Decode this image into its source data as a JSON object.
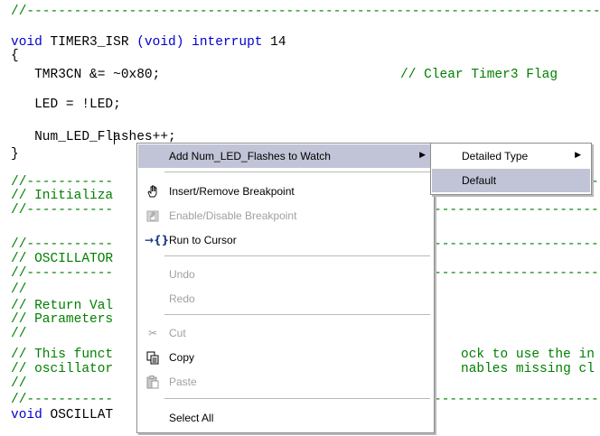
{
  "code_lines": {
    "l1": "//---------------------------------------------------------------------------",
    "l2_void": "void",
    "l2_name": " TIMER3_ISR ",
    "l2_paren": "(void)",
    "l2_interrupt": " interrupt",
    "l2_num": " 14",
    "l3": "{",
    "l4_code": "   TMR3CN &= ~0x80;",
    "l4_comment": "// Clear Timer3 Flag",
    "l5": "   LED = !LED;",
    "l6": "   Num_LED_Flashes++;",
    "l7": "}",
    "l8": "//-----------",
    "l9": "// Initializa",
    "l10": "//-----------",
    "l11": "//-----------",
    "l12": "// OSCILLATOR",
    "l13": "//-----------",
    "l14": "//",
    "l15": "// Return Val",
    "l16": "// Parameters",
    "l17": "//",
    "l18": "// This funct",
    "l19": "// oscillator",
    "l20": "//",
    "l21": "//-----------",
    "l22_void": "void",
    "l22_name": " OSCILLAT",
    "r8": "----------------------",
    "r10": "----------------------",
    "r11": "----------------------",
    "r13": "----------------------",
    "r18": "ock to use the in",
    "r19": "nables missing cl",
    "r21": "----------------------"
  },
  "context_menu": {
    "add_watch": "Add Num_LED_Flashes to Watch",
    "insert_remove_breakpoint": "Insert/Remove Breakpoint",
    "enable_disable_breakpoint": "Enable/Disable Breakpoint",
    "run_to_cursor": "Run to Cursor",
    "undo": "Undo",
    "redo": "Redo",
    "cut": "Cut",
    "copy": "Copy",
    "paste": "Paste",
    "select_all": "Select All"
  },
  "submenu": {
    "detailed_type": "Detailed Type",
    "default": "Default"
  },
  "icons": {
    "submenu_arrow": "triangle-right",
    "breakpoint": "hand-icon",
    "run_to_cursor": "arrow-brace-icon",
    "cut": "scissors-icon",
    "copy": "copy-icon",
    "paste": "clipboard-icon"
  },
  "colors": {
    "comment": "#008000",
    "keyword": "#0000cc",
    "highlight": "#c1c4d6",
    "disabled_text": "#a0a0a0"
  }
}
